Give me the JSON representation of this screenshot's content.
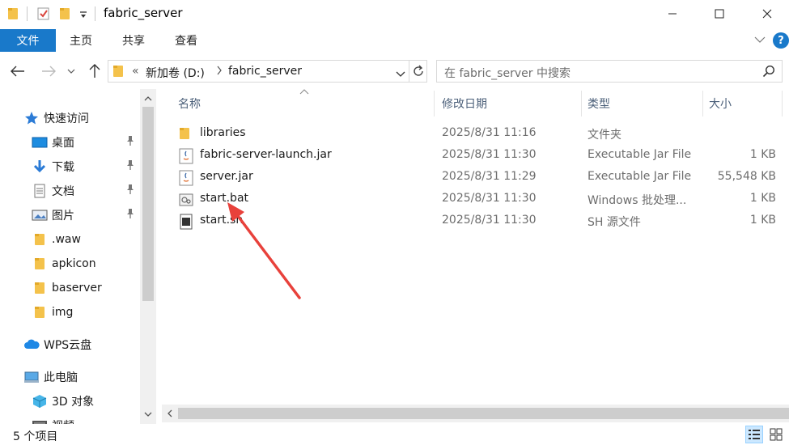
{
  "window": {
    "title": "fabric_server",
    "minimize_icon": "minimize-icon",
    "maximize_icon": "maximize-icon",
    "close_icon": "close-icon"
  },
  "ribbon": {
    "file_tab": "文件",
    "tabs": [
      "主页",
      "共享",
      "查看"
    ],
    "accent": "#1979ca"
  },
  "address": {
    "overflow": "«",
    "crumbs": [
      "新加卷 (D:)",
      "fabric_server"
    ]
  },
  "search": {
    "placeholder": "在 fabric_server 中搜索"
  },
  "nav": {
    "quick_access": "快速访问",
    "items": [
      {
        "label": "桌面",
        "icon": "desktop-icon",
        "pinned": true
      },
      {
        "label": "下载",
        "icon": "download-icon",
        "pinned": true
      },
      {
        "label": "文档",
        "icon": "documents-icon",
        "pinned": true
      },
      {
        "label": "图片",
        "icon": "pictures-icon",
        "pinned": true
      },
      {
        "label": ".waw",
        "icon": "folder-icon",
        "pinned": false
      },
      {
        "label": "apkicon",
        "icon": "folder-icon",
        "pinned": false
      },
      {
        "label": "baserver",
        "icon": "folder-icon",
        "pinned": false
      },
      {
        "label": "img",
        "icon": "folder-icon",
        "pinned": false
      }
    ],
    "wps": "WPS云盘",
    "this_pc": "此电脑",
    "objects_3d": "3D 对象",
    "video": "视频"
  },
  "columns": {
    "name": "名称",
    "date": "修改日期",
    "type": "类型",
    "size": "大小"
  },
  "files": [
    {
      "name": "libraries",
      "date": "2025/8/31 11:16",
      "type": "文件夹",
      "size": "",
      "icon": "folder-icon"
    },
    {
      "name": "fabric-server-launch.jar",
      "date": "2025/8/31 11:30",
      "type": "Executable Jar File",
      "size": "1 KB",
      "icon": "java-jar-icon"
    },
    {
      "name": "server.jar",
      "date": "2025/8/31 11:29",
      "type": "Executable Jar File",
      "size": "55,548 KB",
      "icon": "java-jar-icon"
    },
    {
      "name": "start.bat",
      "date": "2025/8/31 11:30",
      "type": "Windows 批处理...",
      "size": "1 KB",
      "icon": "batch-file-icon"
    },
    {
      "name": "start.sh",
      "date": "2025/8/31 11:30",
      "type": "SH 源文件",
      "size": "1 KB",
      "icon": "shell-script-icon"
    }
  ],
  "status": {
    "item_count": "5 个项目"
  },
  "annotation": {
    "color": "#e8413b"
  }
}
